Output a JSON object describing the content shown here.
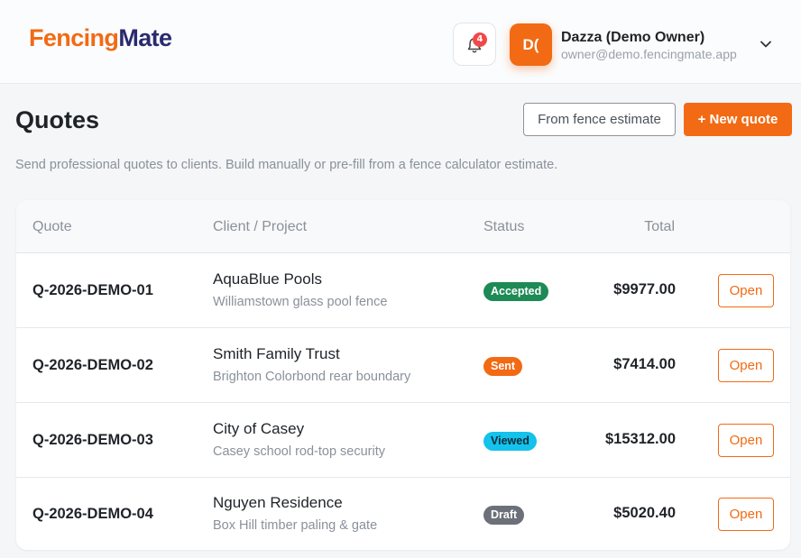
{
  "brand": {
    "logo_part1": "Fencing",
    "logo_part2": "Mate",
    "colors": {
      "accent": "#f26a14",
      "navy": "#2a2a6e"
    }
  },
  "header": {
    "notifications": {
      "icon": "bell-icon",
      "count": "4"
    },
    "user": {
      "initials": "D(",
      "name": "Dazza (Demo Owner)",
      "email": "owner@demo.fencingmate.app",
      "menu_icon": "chevron-down-icon"
    }
  },
  "page": {
    "title": "Quotes",
    "subtitle": "Send professional quotes to clients. Build manually or pre-fill from a fence calculator estimate.",
    "actions": {
      "from_estimate": "From fence estimate",
      "new_quote": "+ New quote"
    }
  },
  "table": {
    "columns": {
      "quote": "Quote",
      "client": "Client / Project",
      "status": "Status",
      "total": "Total"
    },
    "rows": [
      {
        "id": "Q-2026-DEMO-01",
        "client": "AquaBlue Pools",
        "project": "Williamstown glass pool fence",
        "status": "Accepted",
        "status_color": "#1e8a55",
        "total": "$9977.00",
        "action": "Open"
      },
      {
        "id": "Q-2026-DEMO-02",
        "client": "Smith Family Trust",
        "project": "Brighton Colorbond rear boundary",
        "status": "Sent",
        "status_color": "#f26a14",
        "total": "$7414.00",
        "action": "Open"
      },
      {
        "id": "Q-2026-DEMO-03",
        "client": "City of Casey",
        "project": "Casey school rod-top security",
        "status": "Viewed",
        "status_color": "#14c2ec",
        "total": "$15312.00",
        "action": "Open"
      },
      {
        "id": "Q-2026-DEMO-04",
        "client": "Nguyen Residence",
        "project": "Box Hill timber paling & gate",
        "status": "Draft",
        "status_color": "#6b7079",
        "total": "$5020.40",
        "action": "Open"
      }
    ]
  }
}
